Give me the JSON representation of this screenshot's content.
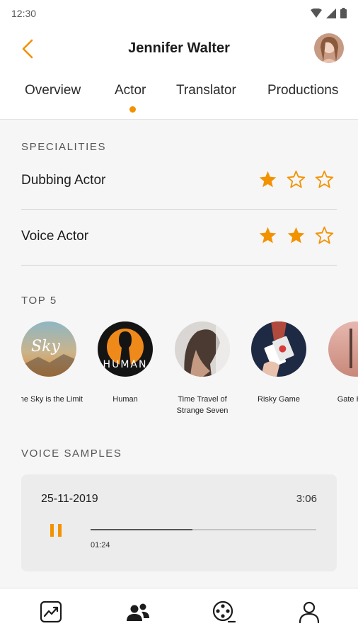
{
  "status_bar": {
    "time": "12:30"
  },
  "header": {
    "title": "Jennifer Walter"
  },
  "tabs": [
    {
      "label": "Overview"
    },
    {
      "label": "Actor",
      "active": true
    },
    {
      "label": "Translator"
    },
    {
      "label": "Productions"
    }
  ],
  "specialities": {
    "heading": "SPECIALITIES",
    "items": [
      {
        "label": "Dubbing Actor",
        "rating": 1,
        "max": 3
      },
      {
        "label": "Voice Actor",
        "rating": 2,
        "max": 3
      }
    ]
  },
  "top5": {
    "heading": "TOP 5",
    "items": [
      {
        "title": "The Sky is the Limit",
        "image_text": "Sky"
      },
      {
        "title": "Human",
        "image_text": "HUMAN"
      },
      {
        "title": "Time Travel of Strange Seven"
      },
      {
        "title": "Risky Game"
      },
      {
        "title": "Gate Heav"
      }
    ]
  },
  "voice_samples": {
    "heading": "VOICE SAMPLES",
    "items": [
      {
        "date": "25-11-2019",
        "duration": "3:06",
        "elapsed": "01:24",
        "progress": 0.45
      }
    ]
  },
  "bottom_nav": [
    {
      "icon": "chart-icon"
    },
    {
      "icon": "people-icon",
      "active": true
    },
    {
      "icon": "film-reel-icon"
    },
    {
      "icon": "profile-icon"
    }
  ],
  "colors": {
    "accent": "#f39200",
    "dark": "#1c1c1c"
  }
}
